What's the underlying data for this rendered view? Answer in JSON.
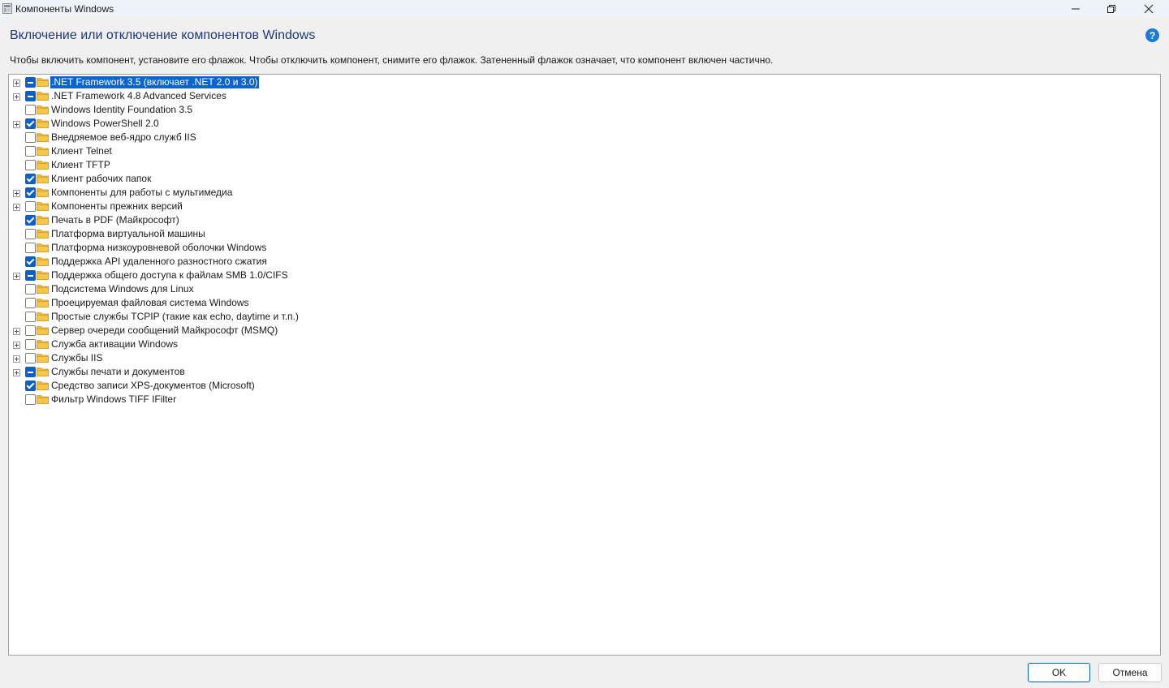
{
  "window": {
    "title": "Компоненты Windows"
  },
  "header": {
    "heading": "Включение или отключение компонентов Windows",
    "instructions": "Чтобы включить компонент, установите его флажок. Чтобы отключить компонент, снимите его флажок. Затененный флажок означает, что компонент включен частично.",
    "help_icon_text": "?"
  },
  "features": [
    {
      "label": ".NET Framework 3.5 (включает .NET 2.0 и 3.0)",
      "state": "partial",
      "expandable": true,
      "selected": true
    },
    {
      "label": ".NET Framework 4.8 Advanced Services",
      "state": "partial",
      "expandable": true,
      "selected": false
    },
    {
      "label": "Windows Identity Foundation 3.5",
      "state": "unchecked",
      "expandable": false,
      "selected": false
    },
    {
      "label": "Windows PowerShell 2.0",
      "state": "checked",
      "expandable": true,
      "selected": false
    },
    {
      "label": "Внедряемое веб-ядро служб IIS",
      "state": "unchecked",
      "expandable": false,
      "selected": false
    },
    {
      "label": "Клиент Telnet",
      "state": "unchecked",
      "expandable": false,
      "selected": false
    },
    {
      "label": "Клиент TFTP",
      "state": "unchecked",
      "expandable": false,
      "selected": false
    },
    {
      "label": "Клиент рабочих папок",
      "state": "checked",
      "expandable": false,
      "selected": false
    },
    {
      "label": "Компоненты для работы с мультимедиа",
      "state": "checked",
      "expandable": true,
      "selected": false
    },
    {
      "label": "Компоненты прежних версий",
      "state": "unchecked",
      "expandable": true,
      "selected": false
    },
    {
      "label": "Печать в PDF (Майкрософт)",
      "state": "checked",
      "expandable": false,
      "selected": false
    },
    {
      "label": "Платформа виртуальной машины",
      "state": "unchecked",
      "expandable": false,
      "selected": false
    },
    {
      "label": "Платформа низкоуровневой оболочки Windows",
      "state": "unchecked",
      "expandable": false,
      "selected": false
    },
    {
      "label": "Поддержка API удаленного разностного сжатия",
      "state": "checked",
      "expandable": false,
      "selected": false
    },
    {
      "label": "Поддержка общего доступа к файлам SMB 1.0/CIFS",
      "state": "partial",
      "expandable": true,
      "selected": false
    },
    {
      "label": "Подсистема Windows для Linux",
      "state": "unchecked",
      "expandable": false,
      "selected": false
    },
    {
      "label": "Проецируемая файловая система Windows",
      "state": "unchecked",
      "expandable": false,
      "selected": false
    },
    {
      "label": "Простые службы TCPIP (такие как echo, daytime и т.п.)",
      "state": "unchecked",
      "expandable": false,
      "selected": false
    },
    {
      "label": "Сервер очереди сообщений Майкрософт (MSMQ)",
      "state": "unchecked",
      "expandable": true,
      "selected": false
    },
    {
      "label": "Служба активации Windows",
      "state": "unchecked",
      "expandable": true,
      "selected": false
    },
    {
      "label": "Службы IIS",
      "state": "unchecked",
      "expandable": true,
      "selected": false
    },
    {
      "label": "Службы печати и документов",
      "state": "partial",
      "expandable": true,
      "selected": false
    },
    {
      "label": "Средство записи XPS-документов (Microsoft)",
      "state": "checked",
      "expandable": false,
      "selected": false
    },
    {
      "label": "Фильтр Windows TIFF IFilter",
      "state": "unchecked",
      "expandable": false,
      "selected": false
    }
  ],
  "buttons": {
    "ok": "OK",
    "cancel": "Отмена"
  },
  "icons": {
    "folder": "folder-icon",
    "expand": "expand-plus-icon",
    "help": "help-icon"
  },
  "colors": {
    "accent": "#0a5fc8",
    "heading": "#1e3a78",
    "folder": "#f5c64a"
  }
}
